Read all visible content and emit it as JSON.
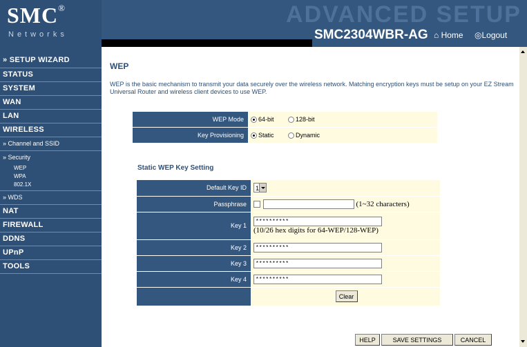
{
  "header": {
    "logo": "SMC",
    "logo_reg": "®",
    "logo_sub": "Networks",
    "banner": "ADVANCED SETUP",
    "model": "SMC2304WBR-AG",
    "home_label": "Home",
    "logout_label": "Logout",
    "home_glyph": "⌂",
    "logout_glyph": "◎"
  },
  "sidebar": {
    "setup_wizard": "» SETUP WIZARD",
    "status": "STATUS",
    "system": "SYSTEM",
    "wan": "WAN",
    "lan": "LAN",
    "wireless": "WIRELESS",
    "channel_ssid": "» Channel and SSID",
    "security": "» Security",
    "wep": "WEP",
    "wpa": "WPA",
    "x8021x": "802.1X",
    "wds": "» WDS",
    "nat": "NAT",
    "firewall": "FIREWALL",
    "ddns": "DDNS",
    "upnp": "UPnP",
    "tools": "TOOLS"
  },
  "main": {
    "title": "WEP",
    "description": "WEP is the basic mechanism to transmit your data securely over the wireless network. Matching encryption keys must be setup on your EZ Stream Universal Router and wireless client devices to use WEP.",
    "wep_mode": {
      "label": "WEP Mode",
      "options": [
        "64-bit",
        "128-bit"
      ],
      "selected": "64-bit"
    },
    "key_provisioning": {
      "label": "Key Provisioning",
      "options": [
        "Static",
        "Dynamic"
      ],
      "selected": "Static"
    },
    "static_section_title": "Static WEP Key Setting",
    "default_key_id": {
      "label": "Default Key ID",
      "value": "1"
    },
    "passphrase": {
      "label": "Passphrase",
      "value": "",
      "hint": "(1~32 characters)"
    },
    "key1": {
      "label": "Key 1",
      "value": "**********",
      "hint": "(10/26 hex digits for 64-WEP/128-WEP)"
    },
    "key2": {
      "label": "Key 2",
      "value": "**********"
    },
    "key3": {
      "label": "Key 3",
      "value": "**********"
    },
    "key4": {
      "label": "Key 4",
      "value": "**********"
    },
    "clear_label": "Clear"
  },
  "footer": {
    "help": "HELP",
    "save": "SAVE SETTINGS",
    "cancel": "CANCEL"
  },
  "colors": {
    "sidebar_bg": "#2e4f76",
    "label_bg": "#33577f",
    "value_bg": "#fffbe0",
    "accent_text": "#2e4f76"
  }
}
